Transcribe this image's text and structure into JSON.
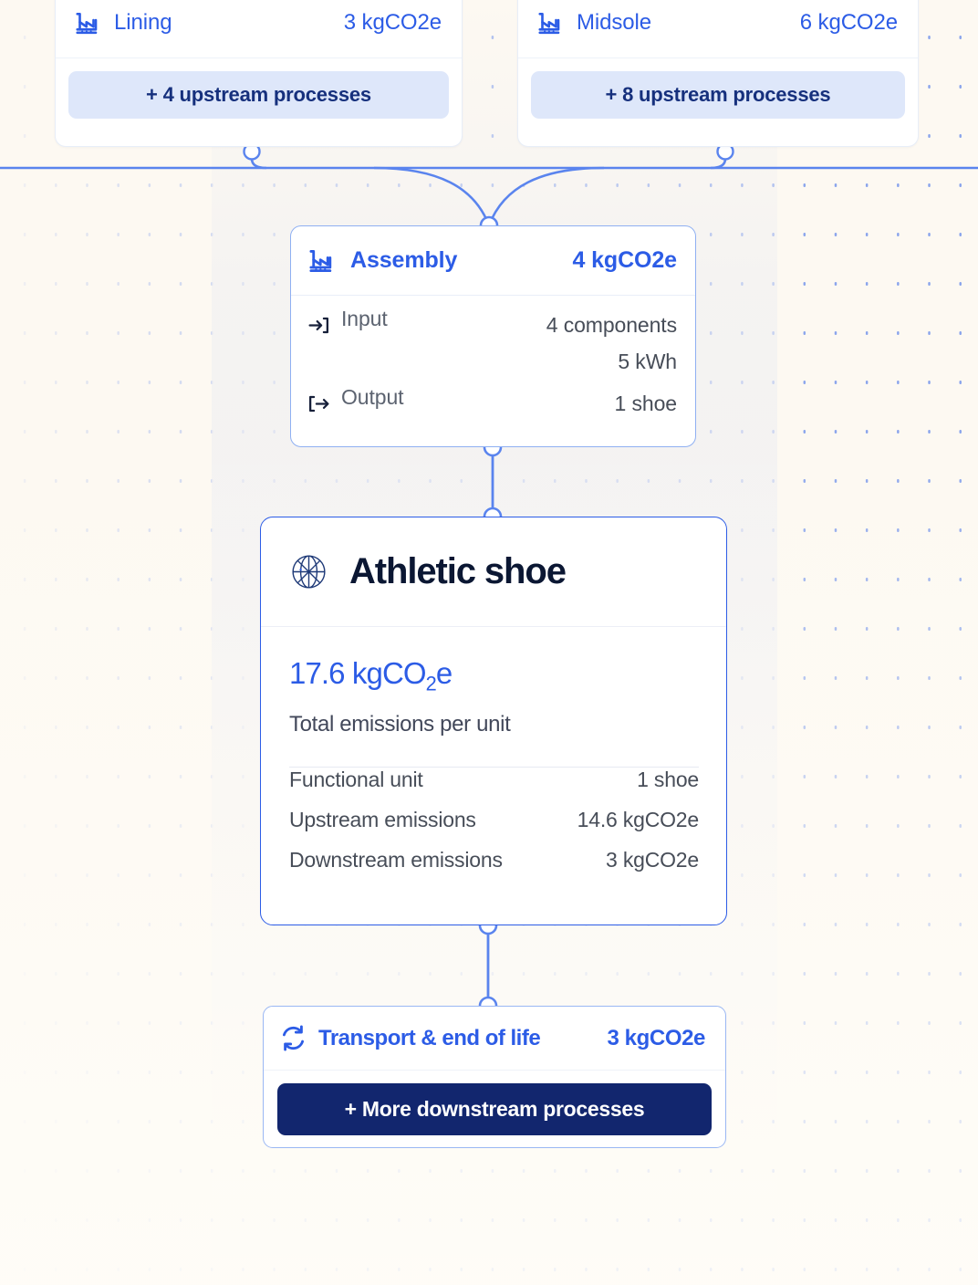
{
  "theme": {
    "background": "#fdf9f2",
    "accent_blue": "#2c5ce6",
    "deep_navy": "#12266e",
    "pill_bg": "#dee7fa",
    "pill_text": "#16307d",
    "title_dark": "#0b1733",
    "muted_text": "#474d58",
    "grid_dot": "#2f62e8"
  },
  "upstream_cards": [
    {
      "id": "lining",
      "icon": "factory-icon",
      "title": "Lining",
      "value": "3 kgCO2e",
      "button_label": "+ 4 upstream processes"
    },
    {
      "id": "midsole",
      "icon": "factory-icon",
      "title": "Midsole",
      "value": "6 kgCO2e",
      "button_label": "+ 8 upstream processes"
    }
  ],
  "assembly": {
    "icon": "factory-icon",
    "title": "Assembly",
    "value": "4 kgCO2e",
    "rows": [
      {
        "icon": "arrow-into-bracket-icon",
        "label": "Input",
        "values": [
          "4 components",
          "5 kWh"
        ]
      },
      {
        "icon": "arrow-out-of-bracket-icon",
        "label": "Output",
        "values": [
          "1 shoe"
        ]
      }
    ]
  },
  "product": {
    "icon": "globe-icon",
    "title": "Athletic shoe",
    "total_value_prefix": "17.6 kgCO",
    "total_value_sub": "2",
    "total_value_suffix": "e",
    "total_caption": "Total emissions per unit",
    "stats": [
      {
        "label": "Functional unit",
        "value": "1 shoe"
      },
      {
        "label": "Upstream emissions",
        "value": "14.6 kgCO2e"
      },
      {
        "label": "Downstream emissions",
        "value": "3 kgCO2e"
      }
    ]
  },
  "transport": {
    "icon": "recycle-refresh-icon",
    "title": "Transport & end of life",
    "value": "3 kgCO2e",
    "button_label": "+ More downstream processes"
  }
}
